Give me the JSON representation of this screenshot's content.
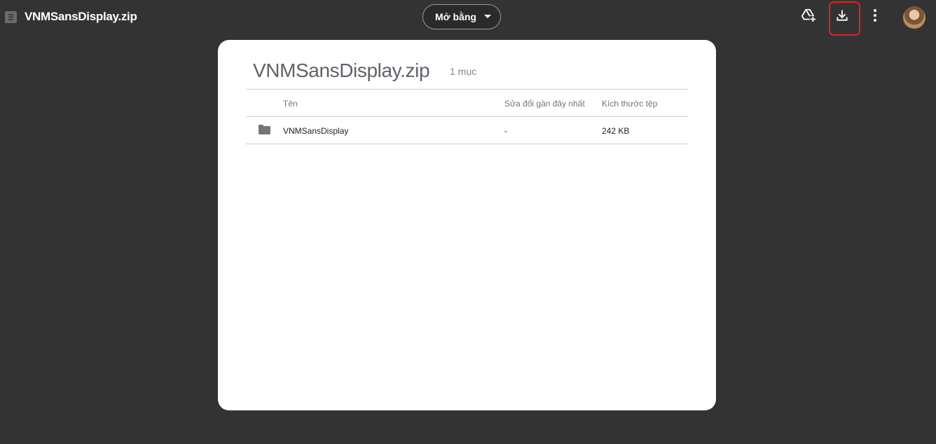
{
  "header": {
    "file_title": "VNMSansDisplay.zip",
    "open_with_label": "Mở bằng",
    "actions": {
      "add_to_drive_icon": "add-to-drive-icon",
      "download_icon": "download-icon",
      "more_icon": "more-vert-icon"
    }
  },
  "panel": {
    "title": "VNMSansDisplay.zip",
    "count": "1 mục",
    "columns": {
      "name": "Tên",
      "modified": "Sửa đổi gần đây nhất",
      "size": "Kích thước tệp"
    },
    "rows": [
      {
        "icon": "folder-icon",
        "name": "VNMSansDisplay",
        "modified": "-",
        "size": "242 KB"
      }
    ]
  },
  "colors": {
    "background": "#333333",
    "panel": "#ffffff",
    "highlight": "#e02020"
  }
}
